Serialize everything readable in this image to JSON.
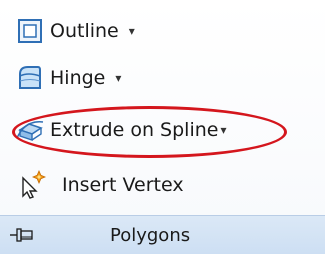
{
  "commands": {
    "outline": {
      "label": "Outline",
      "icon": "outline-square-icon",
      "has_dropdown": true
    },
    "hinge": {
      "label": "Hinge",
      "icon": "hinge-icon",
      "has_dropdown": true
    },
    "extrude": {
      "label": "Extrude on Spline",
      "icon": "extrude-spline-icon",
      "has_dropdown": true,
      "highlighted": true
    },
    "insert_vertex": {
      "label": "Insert Vertex",
      "icon": "insert-vertex-icon",
      "has_dropdown": false
    }
  },
  "caret_glyph": "▾",
  "panel": {
    "title": "Polygons",
    "pin_icon": "pin-icon"
  },
  "colors": {
    "highlight": "#d4161d",
    "icon_blue": "#2f6fb5",
    "footer_bg": "#d3e3f5"
  }
}
